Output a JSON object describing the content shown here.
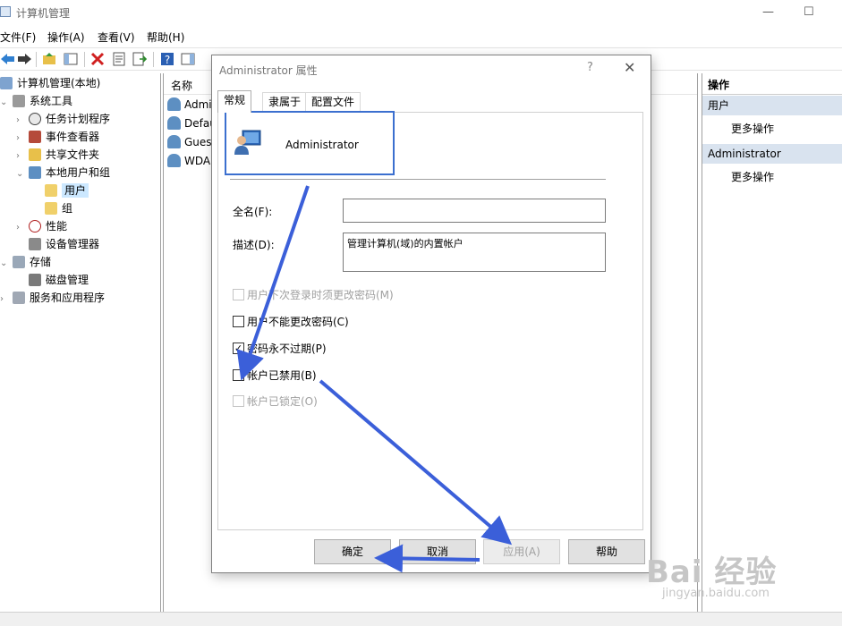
{
  "window": {
    "title": "计算机管理",
    "minimize": "—",
    "maximize": "☐"
  },
  "menu": [
    "文件(F)",
    "操作(A)",
    "查看(V)",
    "帮助(H)"
  ],
  "tree": {
    "root": "计算机管理(本地)",
    "system_tools": "系统工具",
    "task_scheduler": "任务计划程序",
    "event_viewer": "事件查看器",
    "shared_folders": "共享文件夹",
    "local_users": "本地用户和组",
    "users": "用户",
    "groups": "组",
    "performance": "性能",
    "device_manager": "设备管理器",
    "storage": "存储",
    "disk_mgmt": "磁盘管理",
    "services": "服务和应用程序"
  },
  "list": {
    "col_name": "名称",
    "rows": [
      "Admi",
      "Defau",
      "Gues",
      "WDA"
    ]
  },
  "actions": {
    "header": "操作",
    "section1": "用户",
    "more1": "更多操作",
    "section2": "Administrator",
    "more2": "更多操作"
  },
  "dialog": {
    "title": "Administrator 属性",
    "help": "?",
    "close": "✕",
    "tabs": [
      "常规",
      "隶属于",
      "配置文件"
    ],
    "username": "Administrator",
    "fullname_label": "全名(F):",
    "fullname_value": "",
    "desc_label": "描述(D):",
    "desc_value": "管理计算机(域)的内置帐户",
    "checks": {
      "must_change": "用户下次登录时须更改密码(M)",
      "cannot_change": "用户不能更改密码(C)",
      "never_expires": "密码永不过期(P)",
      "disabled": "帐户已禁用(B)",
      "locked": "帐户已锁定(O)"
    },
    "check_mark": "✓",
    "buttons": {
      "ok": "确定",
      "cancel": "取消",
      "apply": "应用(A)",
      "help": "帮助"
    }
  },
  "colors": {
    "accent_blue": "#3b6fcf",
    "arrow_blue": "#3b5fd9",
    "selection": "#cce8ff"
  },
  "watermark": {
    "logo": "Bai 经验",
    "url": "jingyan.baidu.com"
  }
}
